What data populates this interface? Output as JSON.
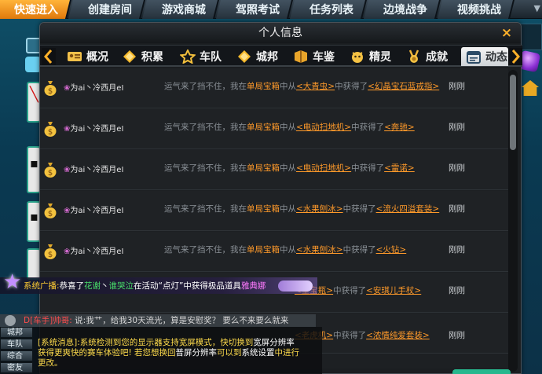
{
  "topbar": {
    "items": [
      {
        "label": "快速进入",
        "active": true
      },
      {
        "label": "创建房间",
        "active": false
      },
      {
        "label": "游戏商城",
        "active": false
      },
      {
        "label": "驾照考试",
        "active": false
      },
      {
        "label": "任务列表",
        "active": false
      },
      {
        "label": "边境战争",
        "active": false
      },
      {
        "label": "视频挑战",
        "active": false
      }
    ]
  },
  "dialog": {
    "title": "个人信息",
    "close": "×",
    "tabs": [
      {
        "label": "概况",
        "icon": "id-card-icon"
      },
      {
        "label": "积累",
        "icon": "diamond-icon"
      },
      {
        "label": "车队",
        "icon": "star-icon"
      },
      {
        "label": "城邦",
        "icon": "diamond-icon"
      },
      {
        "label": "车鉴",
        "icon": "book-icon"
      },
      {
        "label": "精灵",
        "icon": "sprite-icon"
      },
      {
        "label": "成就",
        "icon": "medal-icon"
      },
      {
        "label": "动态",
        "icon": "calendar-icon",
        "active": true
      }
    ]
  },
  "feed": {
    "rows": [
      {
        "user_prefix": "❀",
        "user": "为ai丶冷西月eI",
        "pre": "运气来了挡不住，我在",
        "box": "单局宝箱",
        "mid": "中从",
        "from": "<大青虫>",
        "got": "中获得了",
        "item": "<幻晶宝石蓝戒指>",
        "time": "刚刚"
      },
      {
        "user_prefix": "❀",
        "user": "为ai丶冷西月eI",
        "pre": "运气来了挡不住，我在",
        "box": "单局宝箱",
        "mid": "中从",
        "from": "<电动扫地机>",
        "got": "中获得了",
        "item": "<奔驰>",
        "time": "刚刚"
      },
      {
        "user_prefix": "❀",
        "user": "为ai丶冷西月eI",
        "pre": "运气来了挡不住，我在",
        "box": "单局宝箱",
        "mid": "中从",
        "from": "<电动扫地机>",
        "got": "中获得了",
        "item": "<雷诺>",
        "time": "刚刚"
      },
      {
        "user_prefix": "❀",
        "user": "为ai丶冷西月eI",
        "pre": "运气来了挡不住，我在",
        "box": "单局宝箱",
        "mid": "中从",
        "from": "<水果刨冰>",
        "got": "中获得了",
        "item": "<流火四溢套装>",
        "time": "刚刚"
      },
      {
        "user_prefix": "❀",
        "user": "为ai丶冷西月eI",
        "pre": "运气来了挡不住，我在",
        "box": "单局宝箱",
        "mid": "中从",
        "from": "<水果刨冰>",
        "got": "中获得了",
        "item": "<火钻>",
        "time": "刚刚"
      },
      {
        "user_prefix": "",
        "user": "",
        "pre": "",
        "box": "",
        "mid": "",
        "from": "<星宝瓶>",
        "got": "中获得了",
        "item": "<安琪儿手杖>",
        "time": "刚刚"
      },
      {
        "user_prefix": "",
        "user": "",
        "pre": "",
        "box": "",
        "mid": "",
        "from": "<老虎机>",
        "got": "中获得了",
        "item": "<浓情纯爱套装>",
        "time": "刚刚"
      }
    ]
  },
  "broadcast": {
    "label": "系统广播:",
    "t1": "恭喜了",
    "name1": "花谢",
    "t2": "丶",
    "name2": "谁哭泣",
    "t3": "在活动“点灯”中获得极品道具",
    "item": "雅典娜"
  },
  "chat": {
    "name": "D[车手]帅哥:",
    "text": "说:我艹，给我30天流光，算是安慰奖？ 要么不来要么就来"
  },
  "system": {
    "l1": "[系统消息]:系统检测到您的显示器支持宽屏模式，快切换到",
    "l1b": "宽屏分辨率",
    "l2": "获得更爽快的赛车体验吧! 若您想换回",
    "l2b": "普屏分辨率",
    "l2c": "可以到",
    "l2d": "系统设置",
    "l2e": "中进行",
    "l3": "更改。",
    "tabs": [
      "城邦",
      "车队",
      "综合",
      "密友"
    ]
  }
}
